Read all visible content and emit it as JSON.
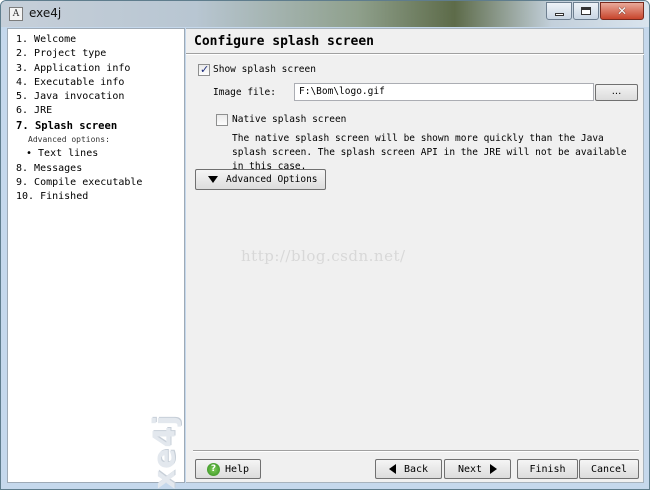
{
  "window": {
    "title": "exe4j",
    "app_icon_glyph": "A"
  },
  "sidebar": {
    "steps": [
      {
        "label": "1.  Welcome"
      },
      {
        "label": "2.  Project type"
      },
      {
        "label": "3.  Application info"
      },
      {
        "label": "4.  Executable info"
      },
      {
        "label": "5.  Java invocation"
      },
      {
        "label": "6.  JRE"
      },
      {
        "label": "7.  Splash screen",
        "current": true
      },
      {
        "label": "Advanced options:"
      },
      {
        "label": "•  Text lines"
      },
      {
        "label": "8.  Messages"
      },
      {
        "label": "9.  Compile executable"
      },
      {
        "label": "10.  Finished"
      }
    ],
    "brand": "exe4j"
  },
  "main": {
    "title": "Configure splash screen",
    "show_splash": {
      "label": "Show splash screen",
      "checked": true
    },
    "image_file": {
      "label": "Image file:",
      "value": "F:\\Bom\\logo.gif",
      "browse_label": "..."
    },
    "native_splash": {
      "label": "Native splash screen",
      "checked": false,
      "description": "The native splash screen will be shown more quickly than the Java splash screen. The splash screen API in the JRE will not be available in this case."
    },
    "advanced_button": "Advanced Options",
    "watermark": "http://blog.csdn.net/"
  },
  "footer": {
    "help": "Help",
    "back": "Back",
    "next": "Next",
    "finish": "Finish",
    "cancel": "Cancel"
  },
  "icons": {
    "minimize": "minimize-icon",
    "maximize": "maximize-icon",
    "close": "close-icon",
    "help": "help-icon",
    "back": "arrow-left-icon",
    "next": "arrow-right-icon",
    "advanced": "triangle-down-icon"
  }
}
